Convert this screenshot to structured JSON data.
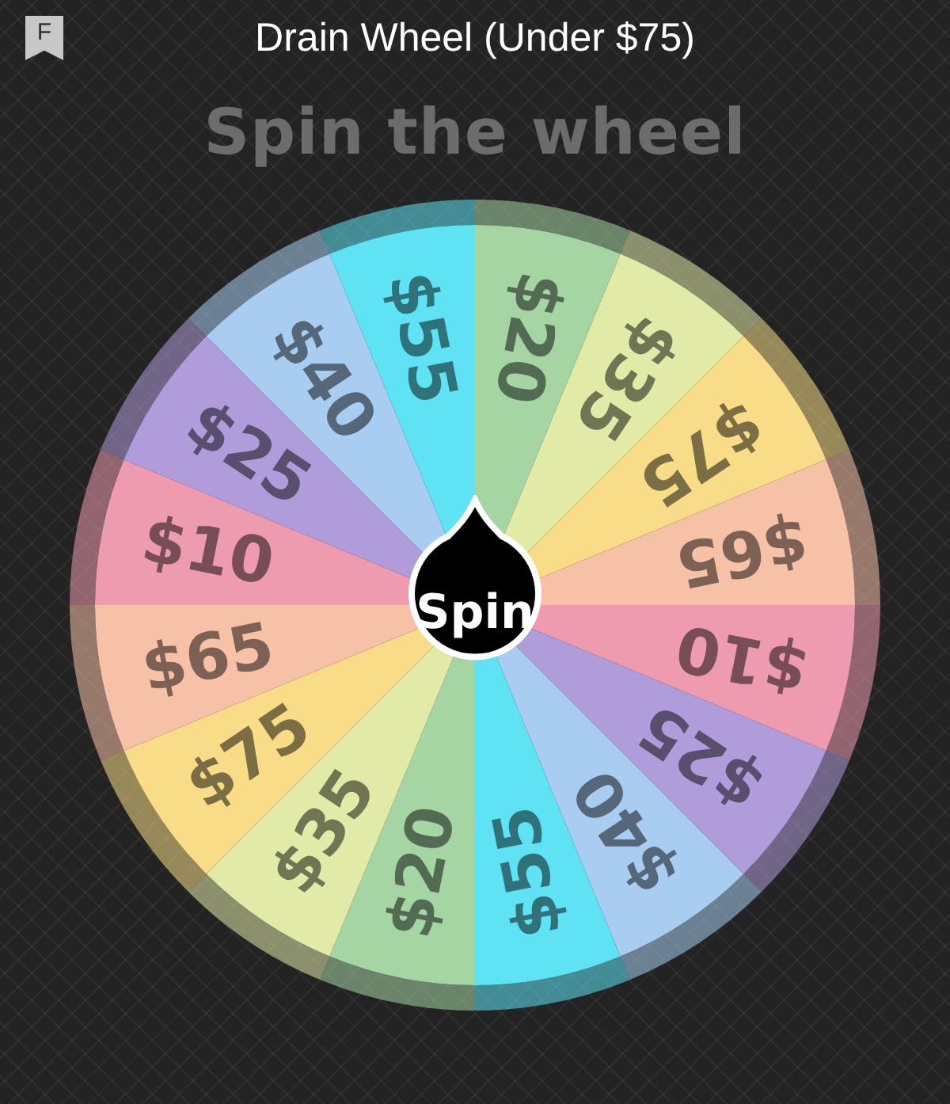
{
  "header": {
    "badge_letter": "F",
    "title": "Drain Wheel (Under $75)"
  },
  "heading": "Spin the wheel",
  "wheel": {
    "segments": [
      {
        "label": "$20",
        "color": "#a6d5a4"
      },
      {
        "label": "$35",
        "color": "#e2eaa8"
      },
      {
        "label": "$75",
        "color": "#f8dc88"
      },
      {
        "label": "$65",
        "color": "#f7c1a8"
      },
      {
        "label": "$10",
        "color": "#ee9bb0"
      },
      {
        "label": "$25",
        "color": "#b09cda"
      },
      {
        "label": "$40",
        "color": "#a9cdf1"
      },
      {
        "label": "$55",
        "color": "#5fe3f4"
      },
      {
        "label": "$20",
        "color": "#a6d5a4"
      },
      {
        "label": "$35",
        "color": "#e2eaa8"
      },
      {
        "label": "$75",
        "color": "#f8dc88"
      },
      {
        "label": "$65",
        "color": "#f7c1a8"
      },
      {
        "label": "$10",
        "color": "#ee9bb0"
      },
      {
        "label": "$25",
        "color": "#b09cda"
      },
      {
        "label": "$40",
        "color": "#a9cdf1"
      },
      {
        "label": "$55",
        "color": "#5fe3f4"
      }
    ],
    "spin_button": "Spin"
  }
}
